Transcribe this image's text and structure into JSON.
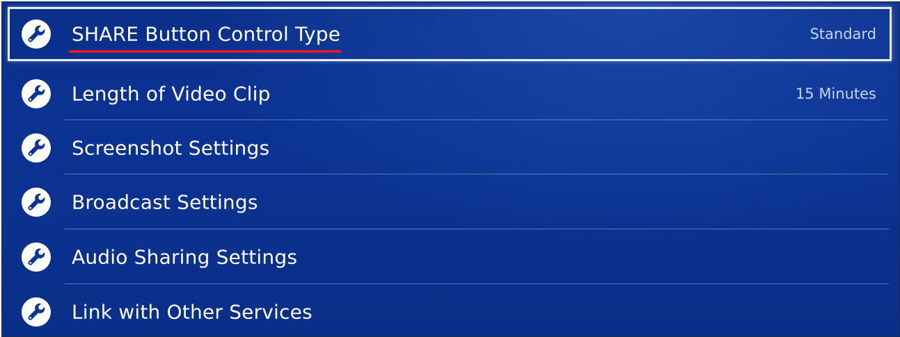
{
  "colors": {
    "background": "#0b3393",
    "selection_border": "#e8ecf6",
    "underline": "#e0182b",
    "text": "#ffffff",
    "value_text": "#c9d3ea"
  },
  "menu": {
    "items": [
      {
        "label": "SHARE Button Control Type",
        "value": "Standard",
        "icon": "wrench-icon",
        "selected": true,
        "annotated": true
      },
      {
        "label": "Length of Video Clip",
        "value": "15 Minutes",
        "icon": "wrench-icon"
      },
      {
        "label": "Screenshot Settings",
        "icon": "wrench-icon"
      },
      {
        "label": "Broadcast Settings",
        "icon": "wrench-icon"
      },
      {
        "label": "Audio Sharing Settings",
        "icon": "wrench-icon"
      },
      {
        "label": "Link with Other Services",
        "icon": "wrench-icon"
      }
    ]
  }
}
